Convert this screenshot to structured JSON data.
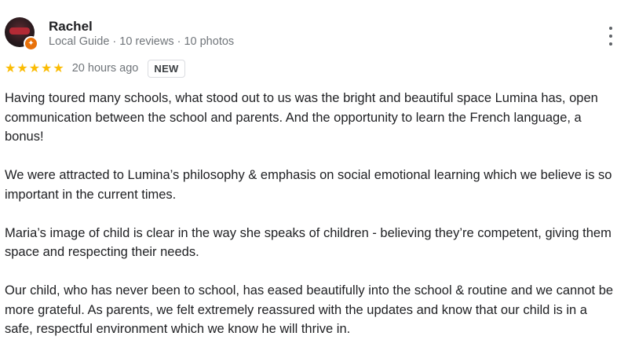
{
  "author": {
    "name": "Rachel",
    "meta": "Local Guide · 10 reviews · 10 photos"
  },
  "rating": {
    "stars": 5,
    "time_ago": "20 hours ago",
    "badge": "NEW"
  },
  "review": {
    "paragraphs": [
      "Having toured many schools, what stood out to us was the bright and beautiful space Lumina has, open communication between the school and parents. And the opportunity to learn the French language, a bonus!",
      "We were attracted to Lumina’s philosophy & emphasis on social emotional learning which we believe is so important in the current times.",
      "Maria’s image of child is clear in the way she speaks of children - believing they’re competent, giving them space and respecting their needs.",
      "Our child, who has never been to school, has eased beautifully into the school & routine and we cannot be more grateful. As parents, we felt extremely reassured with the updates and know that our child is in a safe, respectful environment which we know he will thrive in."
    ]
  },
  "icons": {
    "guide_badge": "local-guide-badge-icon",
    "star": "star-icon",
    "more": "more-vert-icon"
  },
  "colors": {
    "star": "#fbbc04",
    "guide_badge": "#e8710a",
    "meta_text": "#70757a"
  }
}
